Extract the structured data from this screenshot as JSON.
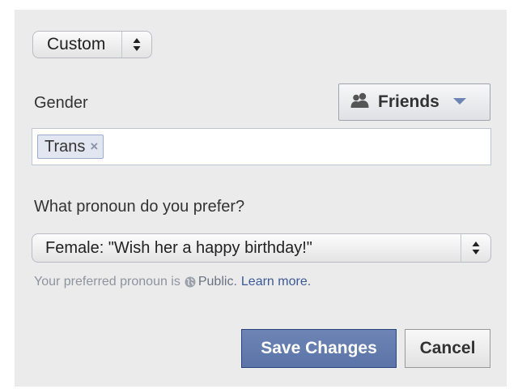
{
  "audience_select": {
    "value": "Custom",
    "icon": "up-down-arrows-icon"
  },
  "gender": {
    "label": "Gender",
    "privacy_button": {
      "label": "Friends",
      "icon": "friends-icon",
      "caret_icon": "caret-down-icon"
    },
    "tokens": [
      {
        "label": "Trans",
        "remove_symbol": "×"
      }
    ]
  },
  "pronoun": {
    "question": "What pronoun do you prefer?",
    "selected": "Female: \"Wish her a happy birthday!\"",
    "note_prefix": "Your preferred pronoun is",
    "note_visibility": "Public.",
    "note_link": "Learn more."
  },
  "actions": {
    "save_label": "Save Changes",
    "cancel_label": "Cancel"
  },
  "colors": {
    "panel_bg": "#ebebeb",
    "primary_button": "#5b74a8",
    "link": "#3b5998"
  }
}
